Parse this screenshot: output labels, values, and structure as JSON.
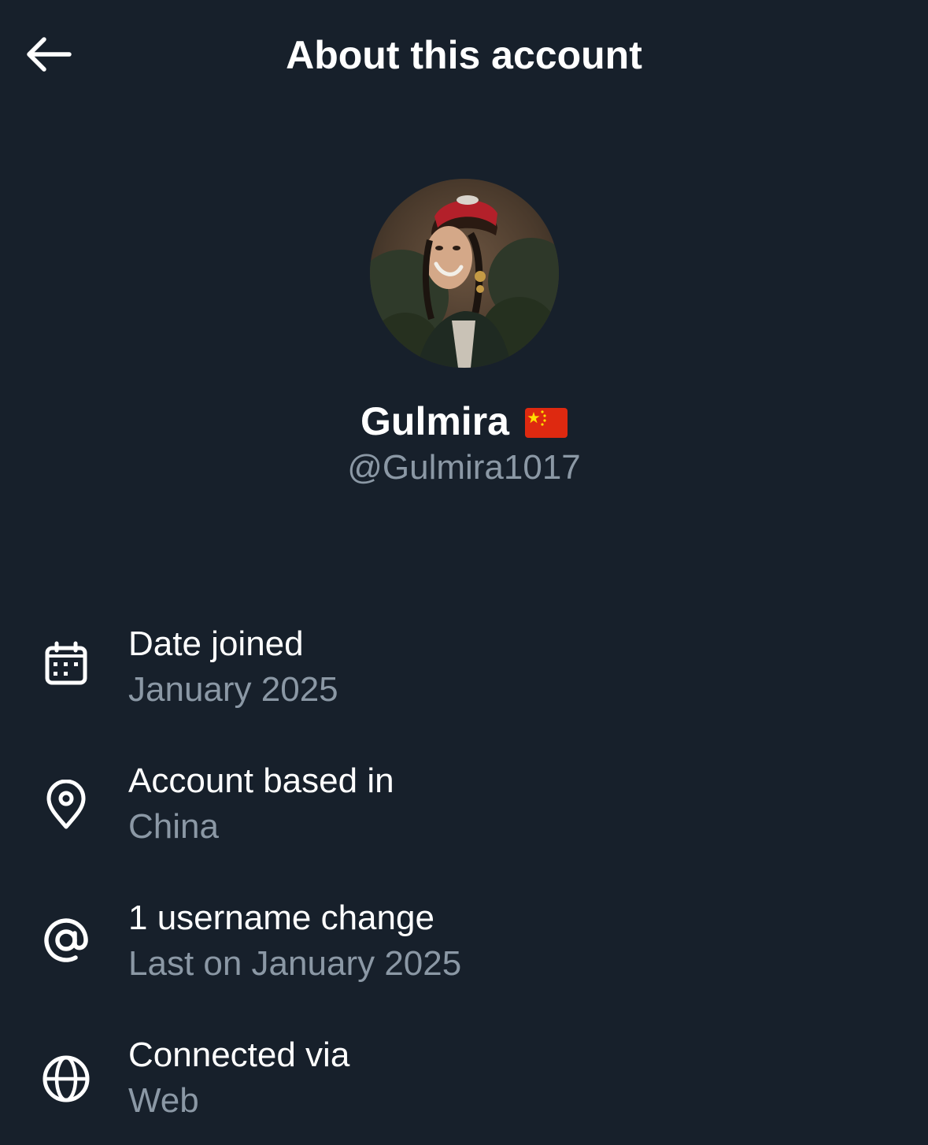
{
  "header": {
    "title": "About this account",
    "back_icon": "arrow-left-icon"
  },
  "profile": {
    "display_name": "Gulmira",
    "flag_icon": "china-flag-icon",
    "handle": "@Gulmira1017"
  },
  "info": [
    {
      "icon": "calendar-icon",
      "label": "Date joined",
      "value": "January 2025"
    },
    {
      "icon": "location-pin-icon",
      "label": "Account based in",
      "value": "China"
    },
    {
      "icon": "at-sign-icon",
      "label": "1 username change",
      "value": "Last on January 2025"
    },
    {
      "icon": "globe-icon",
      "label": "Connected via",
      "value": "Web"
    }
  ],
  "colors": {
    "background": "#17202b",
    "text_primary": "#ffffff",
    "text_secondary": "#8b98a5"
  }
}
